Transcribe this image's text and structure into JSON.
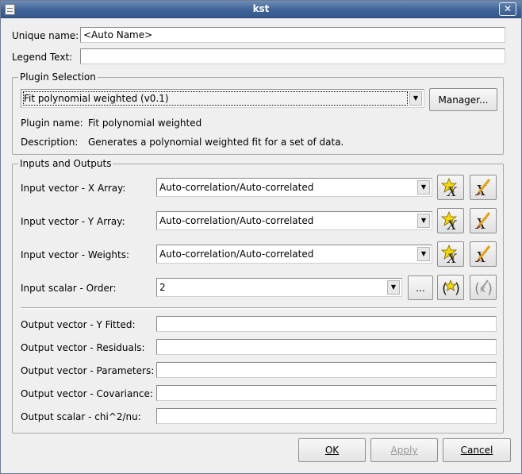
{
  "window": {
    "title": "kst"
  },
  "general": {
    "unique_name_label": "Unique name:",
    "unique_name_value": "<Auto Name>",
    "legend_text_label": "Legend Text:",
    "legend_text_value": ""
  },
  "plugin_selection": {
    "group_title": "Plugin Selection",
    "selected_plugin": "Fit polynomial weighted (v0.1)",
    "manager_label": "Manager...",
    "plugin_name_label": "Plugin name:",
    "plugin_name_value": "Fit polynomial weighted",
    "description_label": "Description:",
    "description_value": "Generates a polynomial weighted fit for a set of data."
  },
  "inputs_outputs": {
    "group_title": "Inputs and Outputs",
    "inputs": [
      {
        "label": "Input vector - X Array:",
        "value": "Auto-correlation/Auto-correlated"
      },
      {
        "label": "Input vector - Y Array:",
        "value": "Auto-correlation/Auto-correlated"
      },
      {
        "label": "Input vector - Weights:",
        "value": "Auto-correlation/Auto-correlated"
      }
    ],
    "scalar_input": {
      "label": "Input scalar - Order:",
      "value": "2",
      "browse_label": "..."
    },
    "outputs": [
      {
        "label": "Output vector - Y Fitted:",
        "value": ""
      },
      {
        "label": "Output vector - Residuals:",
        "value": ""
      },
      {
        "label": "Output vector - Parameters:",
        "value": ""
      },
      {
        "label": "Output vector - Covariance:",
        "value": ""
      },
      {
        "label": "Output scalar - chi^2/nu:",
        "value": ""
      }
    ]
  },
  "buttons": {
    "ok_label": "OK",
    "apply_label": "Apply",
    "cancel_label": "Cancel"
  },
  "icons": {
    "new_vector": "new-vector-icon",
    "edit_vector": "edit-vector-icon",
    "new_scalar": "new-scalar-icon",
    "edit_scalar": "edit-scalar-icon"
  },
  "colors": {
    "titlebar": "#3e6297",
    "dialog_bg": "#efefef",
    "star": "#f5d800",
    "pencil": "#e8a010"
  }
}
